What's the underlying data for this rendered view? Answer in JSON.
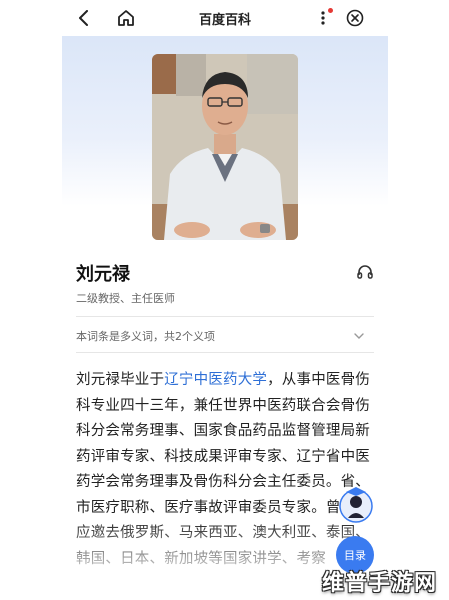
{
  "nav": {
    "title": "百度百科"
  },
  "entry": {
    "name": "刘元禄",
    "subtitle": "二级教授、主任医师",
    "polysemy_note": "本词条是多义词，共2个义项"
  },
  "body": {
    "prefix": "刘元禄毕业于",
    "link": "辽宁中医药大学",
    "suffix": "，从事中医骨伤科专业四十三年，兼任世界中医药联合会骨伤科分会常务理事、国家食品药品监督管理局新药评审专家、科技成果评审专家、辽宁省中医药学会常务理事及骨伤科分会主任委员。省、市医疗职称、医疗事故评审委员专家。曾多次应邀去俄罗斯、马来西亚、澳大利亚、泰国、韩国、日本、新加坡等国家讲学、考察"
  },
  "toc_button": {
    "label": "目录"
  },
  "watermark": "维普手游网",
  "colors": {
    "link": "#2e6fd6",
    "toc": "#3a7bf0",
    "notification": "#e53935"
  },
  "icons": [
    "back-arrow-icon",
    "home-icon",
    "more-vertical-icon",
    "close-circle-icon",
    "headphones-icon",
    "chevron-down-icon",
    "assistant-avatar-icon"
  ]
}
